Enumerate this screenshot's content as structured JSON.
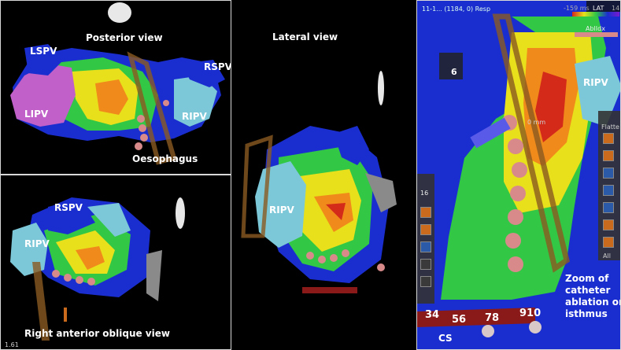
{
  "panels": {
    "posterior": {
      "title": "Posterior view",
      "labels": {
        "lspv": "LSPV",
        "rspv": "RSPV",
        "lipv": "LIPV",
        "ripv": "RIPV",
        "oesophagus": "Oesophagus"
      }
    },
    "rao": {
      "title": "Right anterior oblique view",
      "labels": {
        "rspv": "RSPV",
        "ripv": "RIPV"
      },
      "corner_text": "1.61"
    },
    "lateral": {
      "title": "Lateral view",
      "labels": {
        "ripv": "RIPV"
      }
    },
    "zoom": {
      "header": "11-1... (1184, 0) Resp",
      "lat_label": "LAT",
      "ablidx_label": "AblIdx",
      "scale_left": "-159 ms",
      "scale_right": "14",
      "labels": {
        "ripv": "RIPV",
        "cs": "CS"
      },
      "caption": [
        "Zoom of",
        "catheter",
        "ablation on",
        "isthmus"
      ],
      "distance_label": "6",
      "tool_value": "16",
      "cs_electrodes": [
        "34",
        "56",
        "78",
        "910"
      ],
      "toolbar_label": "Flatte",
      "all_label": "All",
      "dist_text": "0 mm"
    }
  },
  "colors": {
    "red": "#d42a1a",
    "orange": "#f08a1a",
    "yellow": "#e8e01a",
    "green": "#32c846",
    "cyan": "#3ec8c8",
    "blue": "#1a2ed0",
    "purple": "#7a1ad0",
    "lightblue": "#7cc8d8",
    "pink": "#c060c8"
  }
}
